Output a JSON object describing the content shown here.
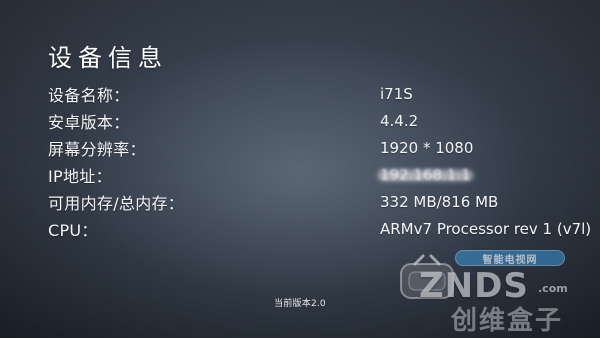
{
  "screen": {
    "title": "设备信息",
    "rows": [
      {
        "label": "设备名称：",
        "value": "i71S"
      },
      {
        "label": "安卓版本：",
        "value": "4.4.2"
      },
      {
        "label": "屏幕分辨率：",
        "value": "1920 * 1080"
      },
      {
        "label": "IP地址：",
        "value": "192.168.1.1"
      },
      {
        "label": "可用内存/总内存：",
        "value": "332 MB/816 MB"
      },
      {
        "label": "CPU：",
        "value": "ARMv7 Processor rev 1 (v7l)"
      }
    ],
    "footer_version": "当前版本2.0"
  },
  "watermark": {
    "top_text": "智能电视网",
    "brand": "ZNDS",
    "domain": ".com",
    "bottom_text": "创维盒子"
  }
}
